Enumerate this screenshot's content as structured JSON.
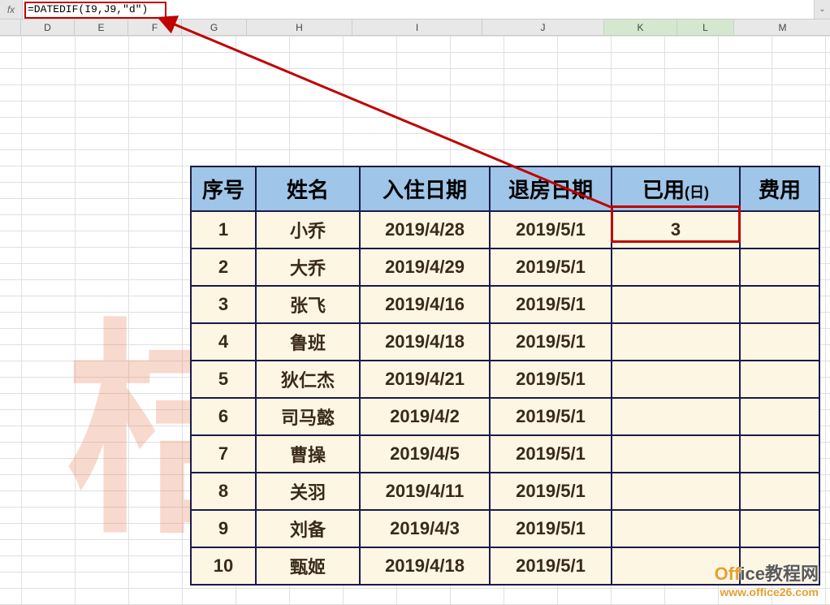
{
  "formula_bar": {
    "fx_label": "fx",
    "formula": "=DATEDIF(I9,J9,\"d\")"
  },
  "columns": [
    "D",
    "E",
    "F",
    "G",
    "H",
    "I",
    "J",
    "K",
    "L",
    "M"
  ],
  "selected_columns": [
    "K",
    "L"
  ],
  "table": {
    "headers": {
      "seq": "序号",
      "name": "姓名",
      "checkin": "入住日期",
      "checkout": "退房日期",
      "used": "已用",
      "used_unit": "(日)",
      "fee": "费用"
    },
    "rows": [
      {
        "seq": "1",
        "name": "小乔",
        "checkin": "2019/4/28",
        "checkout": "2019/5/1",
        "used": "3",
        "fee": ""
      },
      {
        "seq": "2",
        "name": "大乔",
        "checkin": "2019/4/29",
        "checkout": "2019/5/1",
        "used": "",
        "fee": ""
      },
      {
        "seq": "3",
        "name": "张飞",
        "checkin": "2019/4/16",
        "checkout": "2019/5/1",
        "used": "",
        "fee": ""
      },
      {
        "seq": "4",
        "name": "鲁班",
        "checkin": "2019/4/18",
        "checkout": "2019/5/1",
        "used": "",
        "fee": ""
      },
      {
        "seq": "5",
        "name": "狄仁杰",
        "checkin": "2019/4/21",
        "checkout": "2019/5/1",
        "used": "",
        "fee": ""
      },
      {
        "seq": "6",
        "name": "司马懿",
        "checkin": "2019/4/2",
        "checkout": "2019/5/1",
        "used": "",
        "fee": ""
      },
      {
        "seq": "7",
        "name": "曹操",
        "checkin": "2019/4/5",
        "checkout": "2019/5/1",
        "used": "",
        "fee": ""
      },
      {
        "seq": "8",
        "name": "关羽",
        "checkin": "2019/4/11",
        "checkout": "2019/5/1",
        "used": "",
        "fee": ""
      },
      {
        "seq": "9",
        "name": "刘备",
        "checkin": "2019/4/3",
        "checkout": "2019/5/1",
        "used": "",
        "fee": ""
      },
      {
        "seq": "10",
        "name": "甄姬",
        "checkin": "2019/4/18",
        "checkout": "2019/5/1",
        "used": "",
        "fee": ""
      }
    ]
  },
  "watermark": "桔",
  "footer": {
    "line1a": "Off",
    "line1b": "ice教程网",
    "line2": "www.office26.com"
  }
}
